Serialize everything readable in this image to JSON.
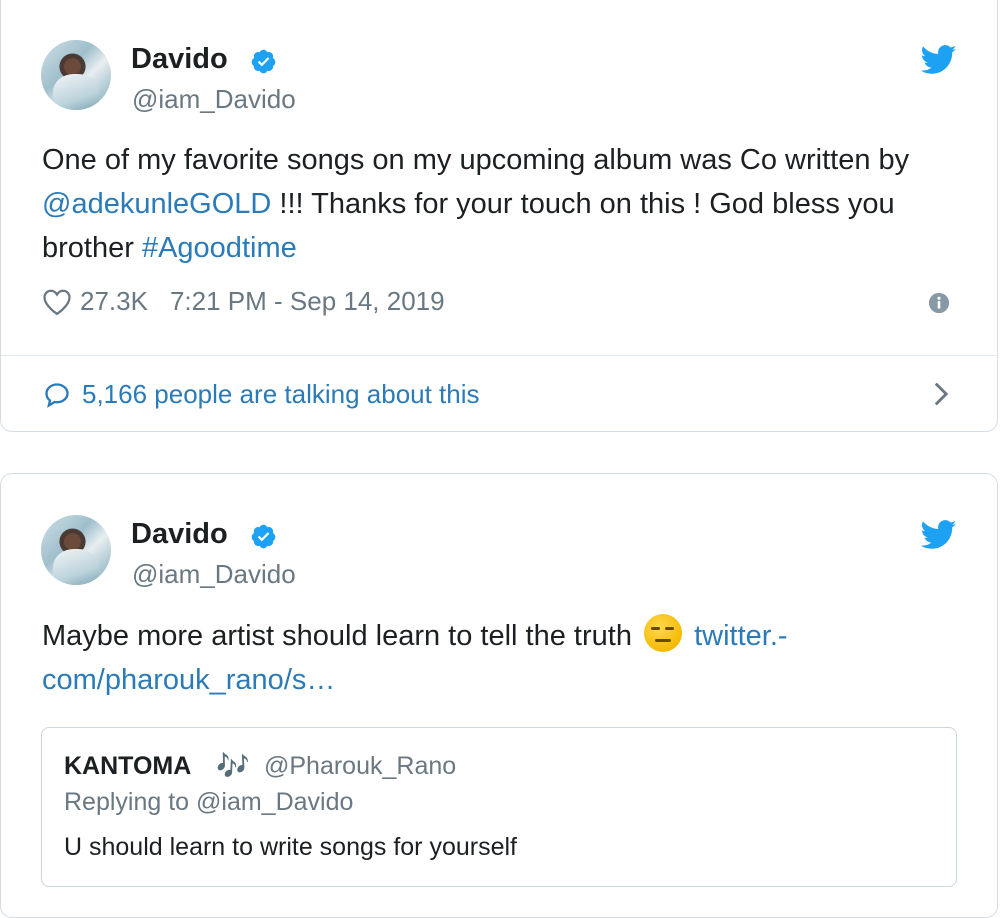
{
  "colors": {
    "link": "#2b7bb9",
    "verified": "#1da1f2",
    "twitter_bird": "#1da1f2",
    "muted": "#697882"
  },
  "tweet1": {
    "name": "Davido",
    "handle": "@iam_Davido",
    "text_before_mention": "One of my favorite songs on my upcoming album was Co written by ",
    "mention": "@adekunleGOLD",
    "text_after_mention": " !!! Thanks for your touch on this ! God bless you brother ",
    "hashtag": "#Agoodtime",
    "likes": "27.3K",
    "timestamp": "7:21 PM - Sep 14, 2019",
    "talking": "5,166 people are talking about this"
  },
  "tweet2": {
    "name": "Davido",
    "handle": "@iam_Davido",
    "text": "Maybe more artist should learn to tell the truth",
    "emoji": "unamused-face-emoji",
    "link_line1": "twitter.-",
    "link_line2": "com/pharouk_rano/s…",
    "quote": {
      "name": "KANTOMA",
      "notes_icon": "🎶",
      "handle": "@Pharouk_Rano",
      "replying": "Replying to @iam_Davido",
      "text": "U should learn to write songs for yourself"
    }
  },
  "icons": {
    "verified": "verified-badge-icon",
    "bird": "twitter-bird-icon",
    "heart": "heart-icon",
    "info": "info-icon",
    "reply": "reply-bubble-icon",
    "chevron": "chevron-right-icon"
  }
}
